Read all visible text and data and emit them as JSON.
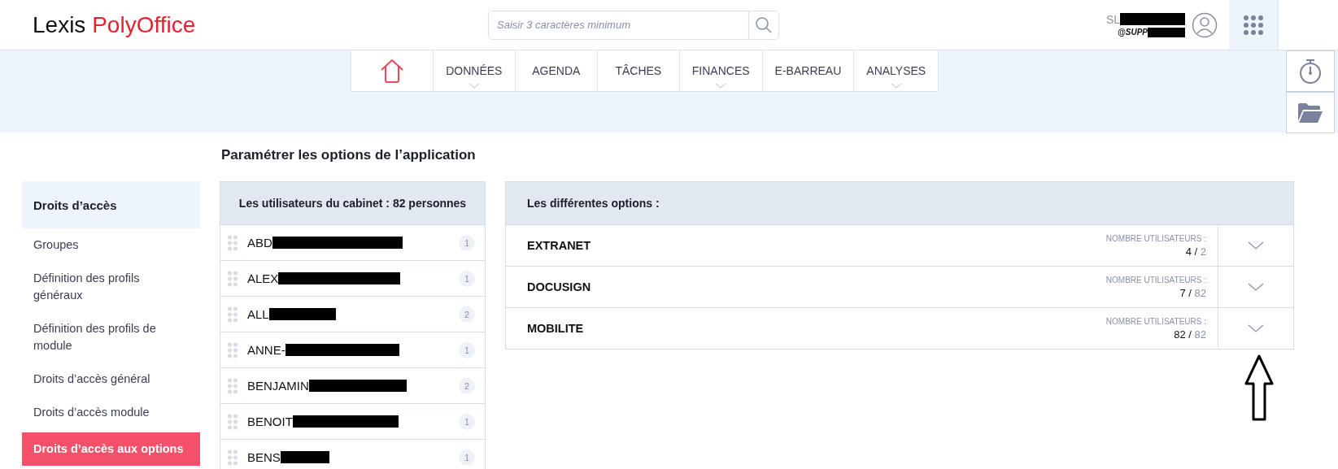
{
  "logo": {
    "first": "Lexis",
    "second": "PolyOffice"
  },
  "search": {
    "placeholder": "Saisir 3 caractères minimum"
  },
  "user": {
    "name": "SL",
    "handle": "@SUPP"
  },
  "nav": [
    {
      "kind": "home"
    },
    {
      "kind": "menu",
      "label": "DONNÉES",
      "dropdown": true
    },
    {
      "kind": "menu",
      "label": "AGENDA",
      "dropdown": false
    },
    {
      "kind": "menu",
      "label": "TÂCHES",
      "dropdown": false
    },
    {
      "kind": "menu",
      "label": "FINANCES",
      "dropdown": true
    },
    {
      "kind": "menu",
      "label": "E-BARREAU",
      "dropdown": false
    },
    {
      "kind": "menu",
      "label": "ANALYSES",
      "dropdown": true
    }
  ],
  "page_title": "Paramétrer les options de l’application",
  "sidebar": {
    "heading": "Droits d’accès",
    "items": [
      {
        "label": "Groupes",
        "selected": false
      },
      {
        "label": "Définition des profils généraux",
        "selected": false
      },
      {
        "label": "Définition des profils de module",
        "selected": false
      },
      {
        "label": "Droits d’accès général",
        "selected": false
      },
      {
        "label": "Droits d’accès module",
        "selected": false
      },
      {
        "label": "Droits d’accès aux options",
        "selected": true
      }
    ]
  },
  "users": {
    "title": "Les utilisateurs du cabinet : 82 personnes",
    "rows": [
      {
        "name": "ABD",
        "redacted": true,
        "count": "1"
      },
      {
        "name": "ALEX",
        "redacted": true,
        "count": "1"
      },
      {
        "name": "ALL",
        "redacted": true,
        "count": "2"
      },
      {
        "name": "ANNE-",
        "redacted": true,
        "count": "1"
      },
      {
        "name": "BENJAMIN",
        "redacted": true,
        "count": "2"
      },
      {
        "name": "BENOIT",
        "redacted": true,
        "count": "1"
      },
      {
        "name": "BENS",
        "redacted": true,
        "count": "1"
      }
    ]
  },
  "options": {
    "title": "Les différentes options :",
    "rows": [
      {
        "name": "EXTRANET",
        "count_label": "NOMBRE UTILISATEURS :",
        "used": "4",
        "separator": "/",
        "total": "2",
        "expanded": false
      },
      {
        "name": "DOCUSIGN",
        "count_label": "NOMBRE UTILISATEURS :",
        "used": "7",
        "separator": "/",
        "total": "82",
        "expanded": false
      },
      {
        "name": "MOBILITE",
        "count_label": "NOMBRE UTILISATEURS :",
        "used": "82",
        "separator": "/",
        "total": "82",
        "expanded": false
      }
    ]
  }
}
